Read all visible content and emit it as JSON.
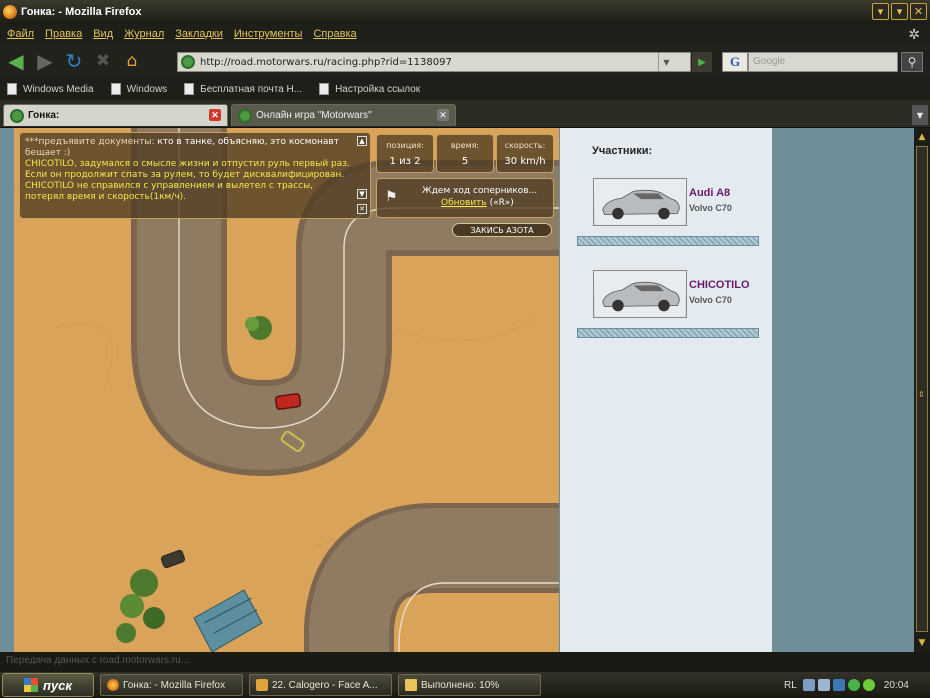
{
  "window": {
    "title": "Гонка: - Mozilla Firefox",
    "controls": [
      "▾",
      "▾",
      "✕"
    ]
  },
  "menu": [
    "Файл",
    "Правка",
    "Вид",
    "Журнал",
    "Закладки",
    "Инструменты",
    "Справка"
  ],
  "nav": {
    "url": "http://road.motorwars.ru/racing.php?rid=1138097",
    "search_placeholder": "Google",
    "search_logo": "G"
  },
  "bookmarks": [
    "Windows Media",
    "Windows",
    "Бесплатная почта Н...",
    "Настройка ссылок"
  ],
  "tabs": [
    {
      "label": "Гонка:",
      "active": true
    },
    {
      "label": "Онлайн игра \"Motorwars\"",
      "active": false
    }
  ],
  "game": {
    "chat": {
      "line1_prefix": "***предъявите документы: ",
      "line1_rest": "кто в танке, объясняю, это космонавт",
      "line2": "бещает :)",
      "line3": "CHICOTILO, задумался о смысле жизни и отпустил руль первый раз.",
      "line4": "Если он продолжит спать за рулем, то будет дисквалифицирован.",
      "line5": "CHICOTILO не справился с управлением и вылетел с трассы,",
      "line6": "потерял время и скорость(1км/ч)."
    },
    "stats": [
      {
        "label": "позиция:",
        "value": "1 из 2"
      },
      {
        "label": "время:",
        "value": "5"
      },
      {
        "label": "скорость:",
        "value": "30 km/h"
      }
    ],
    "waiting": {
      "text": "Ждем ход соперников...",
      "refresh_link": "Обновить",
      "hotkey": "(«R»)"
    },
    "nitro_button": "ЗАКИСЬ АЗОТА"
  },
  "sidebar": {
    "header": "Участники:",
    "participants": [
      {
        "name": "Audi A8",
        "model": "Volvo C70"
      },
      {
        "name": "CHICOTILO",
        "model": "Volvo C70"
      }
    ]
  },
  "statusbar": {
    "text": "Передача данных с road.motorwars.ru..."
  },
  "taskbar": {
    "start": "пуск",
    "tasks": [
      "Гонка: - Mozilla Firefox",
      "22. Calogero - Face A...",
      "Выполнено: 10%"
    ],
    "lang": "RL",
    "clock": "20:04"
  },
  "colors": {
    "accent": "#e2c55c",
    "sand": "#d9a35a",
    "road": "#8b7359",
    "participant_name": "#6a1a6a",
    "chat_highlight": "#f5e84b"
  }
}
